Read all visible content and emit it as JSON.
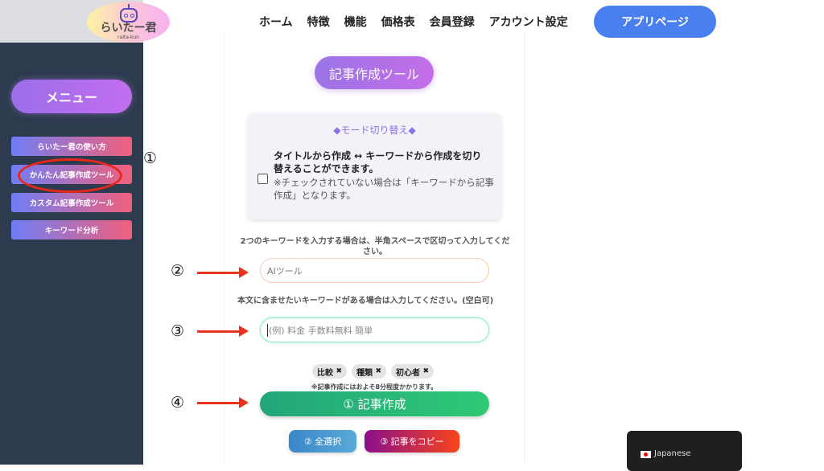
{
  "header": {
    "logo": {
      "title": "らいたー君",
      "subtitle": "raita-kun"
    },
    "nav": [
      "ホーム",
      "特徴",
      "機能",
      "価格表",
      "会員登録",
      "アカウント設定"
    ],
    "app_button": "アプリページ"
  },
  "sidebar": {
    "menu_label": "メニュー",
    "items": [
      {
        "label": "らいたー君の使い方"
      },
      {
        "label": "かんたん記事作成ツール",
        "highlighted": true
      },
      {
        "label": "カスタム記事作成ツール"
      },
      {
        "label": "キーワード分析"
      }
    ]
  },
  "annotations": {
    "step1": "①",
    "step2": "②",
    "step3": "③",
    "step4": "④",
    "highlight_color": "#e8271a"
  },
  "main": {
    "tool_title": "記事作成ツール",
    "mode": {
      "title": "◆モード切り替え◆",
      "description": "タイトルから作成 ↔ キーワードから作成を切り替えることができます。",
      "note": "※チェックされていない場合は「キーワードから記事作成」となります。",
      "checked": false
    },
    "keyword_label": "2つのキーワードを入力する場合は、半角スペースで区切って入力してください。",
    "keyword_value": "AIツール",
    "include_label": "本文に含ませたいキーワードがある場合は入力してください。(空白可)",
    "include_placeholder": "(例) 料金  手数料無料  簡単",
    "tags": [
      {
        "label": "比較",
        "remove_icon": "✖"
      },
      {
        "label": "種類",
        "remove_icon": "✖"
      },
      {
        "label": "初心者",
        "remove_icon": "✖"
      }
    ],
    "time_note": "※記事作成にはおよそ8分程度かかります。",
    "create_button": "① 記事作成",
    "select_all_button": "② 全選択",
    "copy_button": "③ 記事をコピー"
  },
  "language_widget": {
    "flag": "japan-flag",
    "label": "Japanese"
  }
}
